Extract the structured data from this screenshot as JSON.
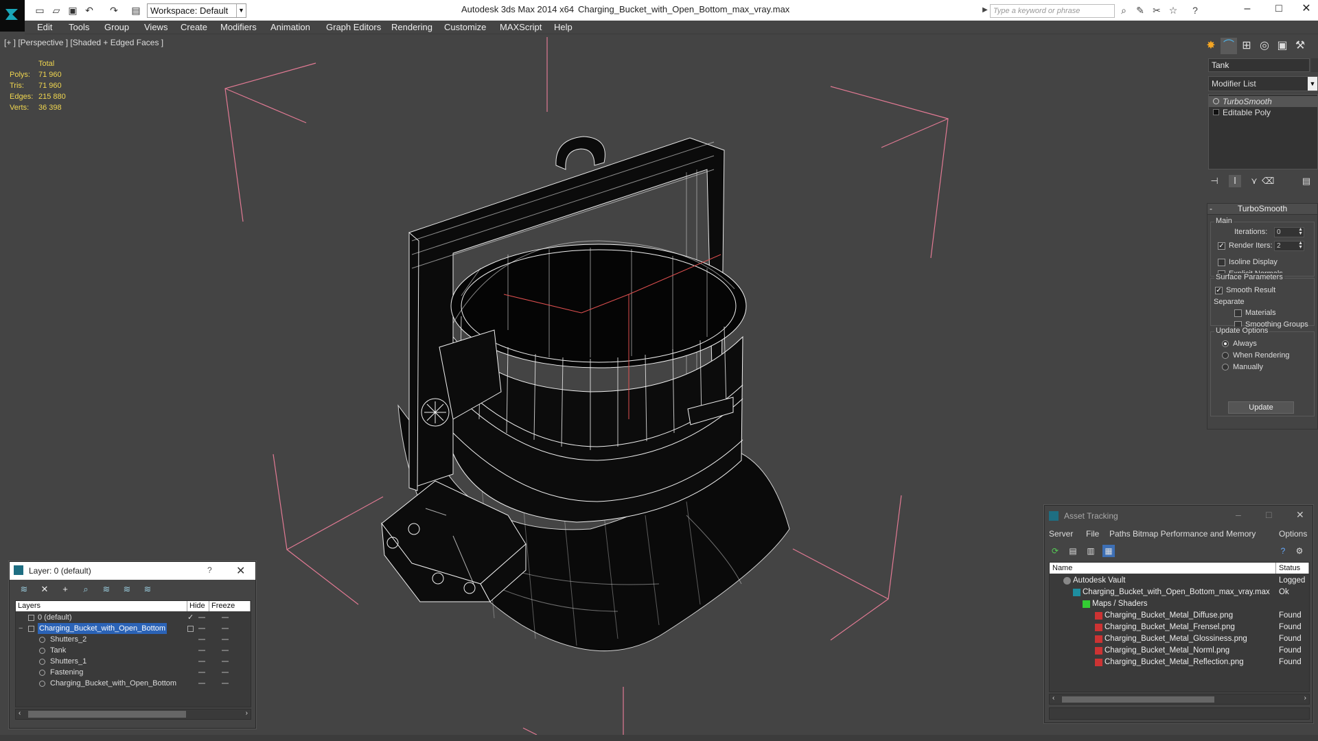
{
  "titlebar": {
    "workspace": "Workspace: Default",
    "app_title": "Autodesk 3ds Max  2014 x64",
    "file_title": "Charging_Bucket_with_Open_Bottom_max_vray.max",
    "search_placeholder": "Type a keyword or phrase"
  },
  "menu": [
    "Edit",
    "Tools",
    "Group",
    "Views",
    "Create",
    "Modifiers",
    "Animation",
    "Graph Editors",
    "Rendering",
    "Customize",
    "MAXScript",
    "Help"
  ],
  "viewport": {
    "label": "[+ ] [Perspective ] [Shaded + Edged Faces ]",
    "stats": {
      "header": "Total",
      "rows": [
        {
          "label": "Polys:",
          "value": "71 960"
        },
        {
          "label": "Tris:",
          "value": "71 960"
        },
        {
          "label": "Edges:",
          "value": "215 880"
        },
        {
          "label": "Verts:",
          "value": "36 398"
        }
      ]
    }
  },
  "command_panel": {
    "object_name": "Tank",
    "modifier_list": "Modifier List",
    "stack": [
      "TurboSmooth",
      "Editable Poly"
    ],
    "turbosmooth": {
      "title": "TurboSmooth",
      "main": "Main",
      "iterations_label": "Iterations:",
      "iterations_value": "0",
      "render_iters_label": "Render Iters:",
      "render_iters_value": "2",
      "isoline": "Isoline Display",
      "explicit_normals": "Explicit Normals",
      "surface_params": "Surface Parameters",
      "smooth_result": "Smooth Result",
      "separate": "Separate",
      "materials": "Materials",
      "smoothing_groups": "Smoothing Groups",
      "update_options": "Update Options",
      "always": "Always",
      "when_rendering": "When Rendering",
      "manually": "Manually",
      "update_button": "Update"
    }
  },
  "layer_dialog": {
    "title": "Layer: 0 (default)",
    "help": "?",
    "col_layers": "Layers",
    "col_hide": "Hide",
    "col_freeze": "Freeze",
    "rows": [
      {
        "name": "0 (default)",
        "level": 0
      },
      {
        "name": "Charging_Bucket_with_Open_Bottom",
        "level": 0
      },
      {
        "name": "Shutters_2",
        "level": 1
      },
      {
        "name": "Tank",
        "level": 1
      },
      {
        "name": "Shutters_1",
        "level": 1
      },
      {
        "name": "Fastening",
        "level": 1
      },
      {
        "name": "Charging_Bucket_with_Open_Bottom",
        "level": 1
      }
    ]
  },
  "asset_tracking": {
    "title": "Asset Tracking",
    "menu": [
      "Server",
      "File",
      "Paths",
      "Bitmap Performance and Memory",
      "Options"
    ],
    "col_name": "Name",
    "col_status": "Status",
    "rows": [
      {
        "name": "Autodesk Vault",
        "status": "Logged"
      },
      {
        "name": "Charging_Bucket_with_Open_Bottom_max_vray.max",
        "status": "Ok"
      },
      {
        "name": "Maps / Shaders",
        "status": ""
      },
      {
        "name": "Charging_Bucket_Metal_Diffuse.png",
        "status": "Found"
      },
      {
        "name": "Charging_Bucket_Metal_Frensel.png",
        "status": "Found"
      },
      {
        "name": "Charging_Bucket_Metal_Glossiness.png",
        "status": "Found"
      },
      {
        "name": "Charging_Bucket_Metal_Norml.png",
        "status": "Found"
      },
      {
        "name": "Charging_Bucket_Metal_Reflection.png",
        "status": "Found"
      }
    ]
  },
  "colors": {
    "viewport_bg": "#444444",
    "stats_text": "#f0d650",
    "selection": "#2b63b6",
    "bounding_box": "#e27a94"
  }
}
